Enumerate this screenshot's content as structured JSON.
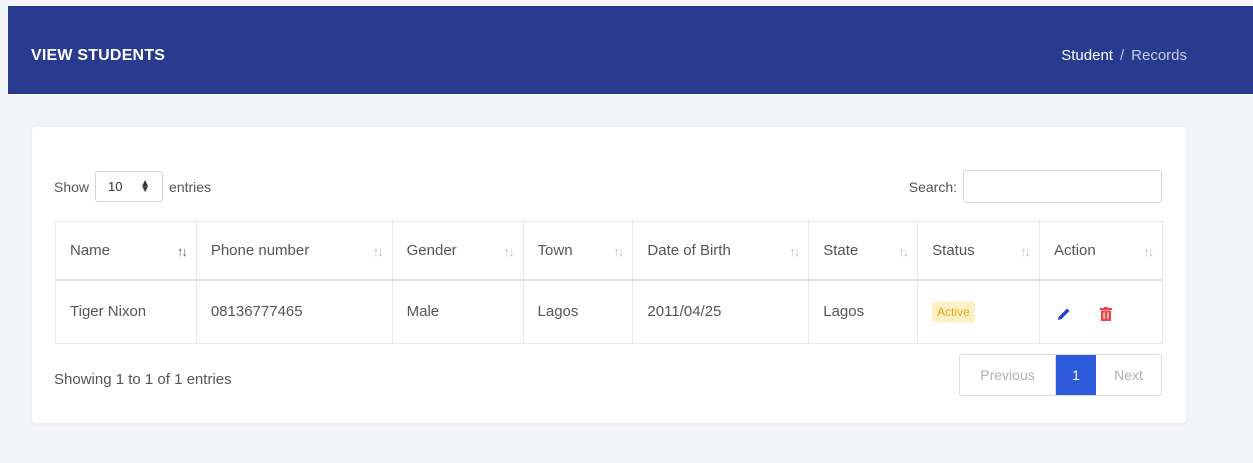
{
  "header": {
    "title": "VIEW STUDENTS",
    "breadcrumb": [
      "Student",
      "Records"
    ],
    "background": "#283b8f"
  },
  "controls": {
    "show_label": "Show",
    "entries_value": "10",
    "entries_label": "entries",
    "search_label": "Search:",
    "search_value": ""
  },
  "table": {
    "columns": [
      "Name",
      "Phone number",
      "Gender",
      "Town",
      "Date of Birth",
      "State",
      "Status",
      "Action"
    ],
    "sorted_column": "Name",
    "rows": [
      {
        "name": "Tiger Nixon",
        "phone": "08136777465",
        "gender": "Male",
        "town": "Lagos",
        "dob": "2011/04/25",
        "state": "Lagos",
        "status": "Active",
        "actions": [
          "pencil-icon",
          "trash-icon"
        ]
      }
    ]
  },
  "footer": {
    "info": "Showing 1 to 1 of 1 entries",
    "pagination": {
      "previous": "Previous",
      "current_page": "1",
      "next": "Next"
    }
  },
  "colors": {
    "accent": "#2e5bdb",
    "status_active_bg": "#fdf0c5",
    "status_active_text": "#e6a817",
    "edit": "#2346c6",
    "delete": "#f2464a"
  }
}
